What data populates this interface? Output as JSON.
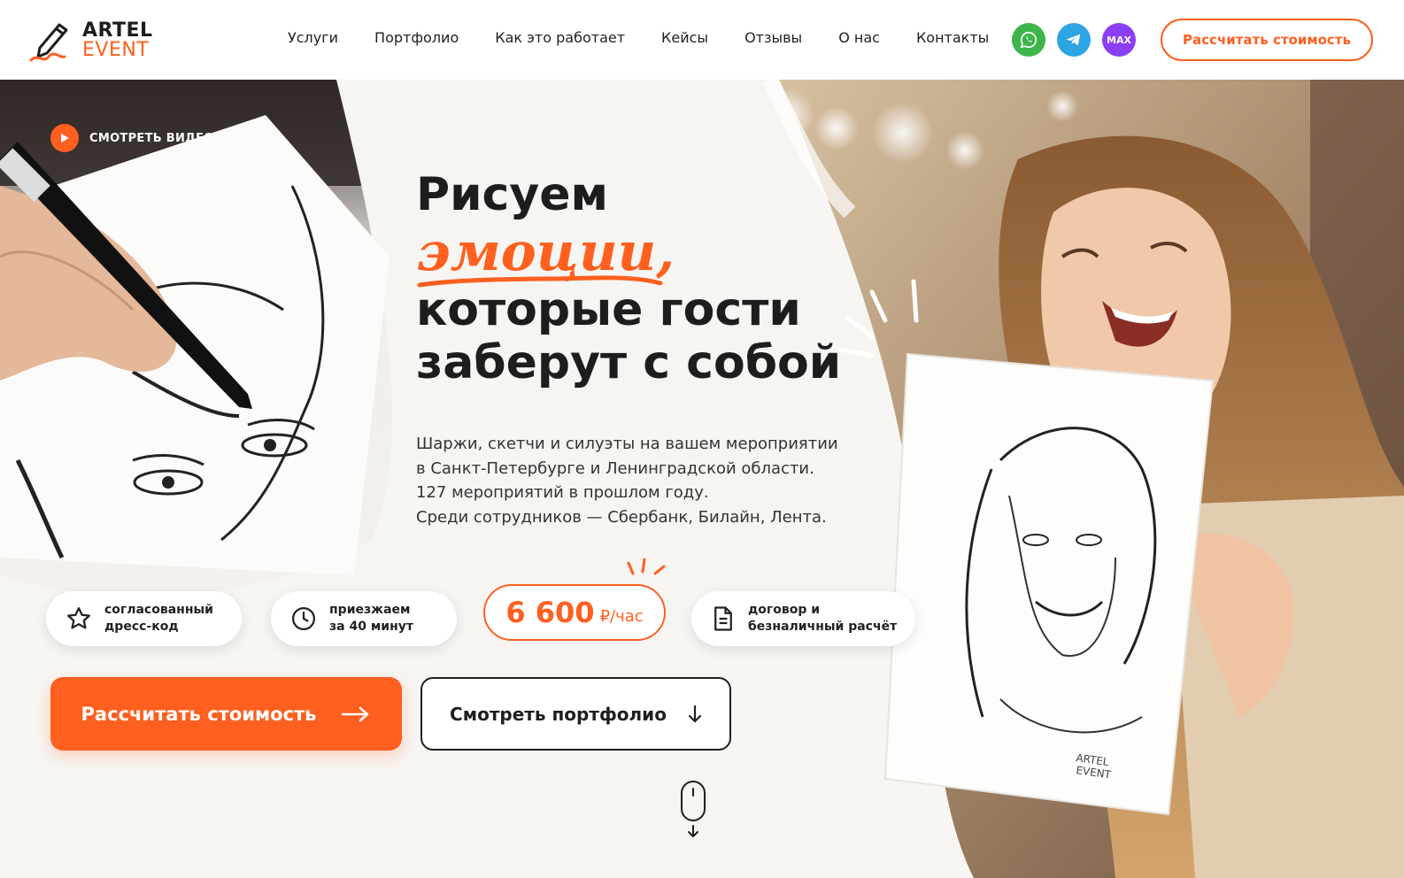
{
  "header": {
    "logo_line1": "ARTEL",
    "logo_line2": "EVENT",
    "nav": [
      "Услуги",
      "Портфолио",
      "Как это работает",
      "Кейсы",
      "Отзывы",
      "О нас",
      "Контакты"
    ],
    "socials": {
      "whatsapp": "whatsapp-icon",
      "telegram": "telegram-icon",
      "max": "MAX"
    },
    "cta_label": "Рассчитать стоимость"
  },
  "hero": {
    "video_label": "СМОТРЕТЬ ВИДЕО",
    "headline_1": "Рисуем",
    "headline_accent": "эмоции,",
    "headline_2": "которые гости",
    "headline_3": "заберут с собой",
    "subtitle": [
      "Шаржи, скетчи и силуэты на вашем мероприятии",
      "в Санкт-Петербурге и Ленинградской области.",
      "127 мероприятий в прошлом году.",
      "Среди сотрудников — Сбербанк, Билайн, Лента."
    ],
    "features": [
      {
        "icon": "star-icon",
        "line1": "согласованный",
        "line2": "дресс-код"
      },
      {
        "icon": "clock-icon",
        "line1": "приезжаем",
        "line2": "за 40 минут"
      },
      {
        "icon": "document-icon",
        "line1": "договор и",
        "line2": "безналичный расчёт"
      }
    ],
    "price_amount": "6 600",
    "price_unit": "₽/час",
    "cta_primary": "Рассчитать стоимость",
    "cta_secondary": "Смотреть портфолио",
    "sketch_signature": "ARTEL EVENT"
  },
  "colors": {
    "accent": "#ff5f1f",
    "whatsapp": "#3cb54a",
    "telegram": "#2da5e2",
    "max": "#8a3ff2",
    "text": "#1d1d1d"
  }
}
